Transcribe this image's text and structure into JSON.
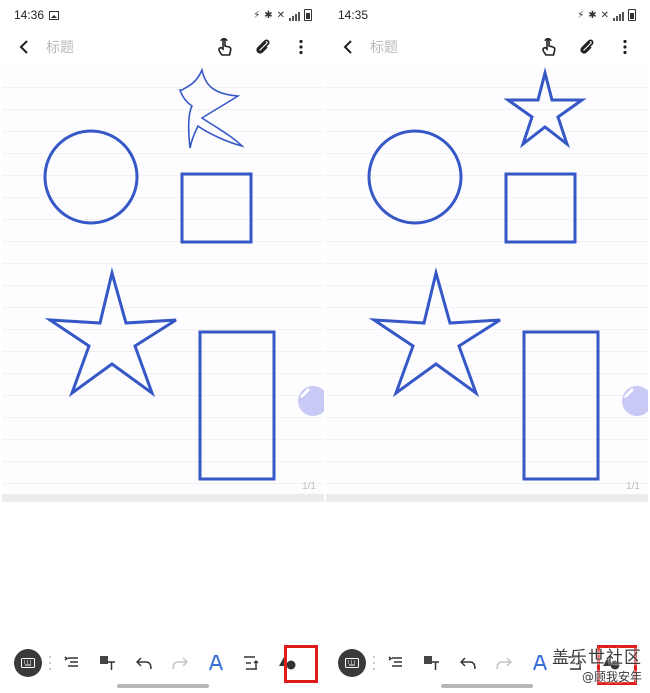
{
  "colors": {
    "shape_stroke": "#3558c6",
    "highlight": "#e01b1b",
    "fab": "#c8c9f5"
  },
  "screens": [
    {
      "status": {
        "time": "14:36"
      },
      "header": {
        "title_placeholder": "标题"
      },
      "canvas": {
        "page_indicator": "1/1",
        "shapes": [
          "hand-drawn-star",
          "circle",
          "square",
          "star",
          "tall-rectangle"
        ]
      },
      "toolbar": {
        "tools": [
          "keyboard-icon",
          "text-align-icon",
          "handwriting-to-text-icon",
          "undo-icon",
          "redo-icon",
          "pen-style-icon",
          "text-size-icon",
          "shape-recognition-icon"
        ]
      }
    },
    {
      "status": {
        "time": "14:35"
      },
      "header": {
        "title_placeholder": "标题"
      },
      "canvas": {
        "page_indicator": "1/1",
        "shapes": [
          "star",
          "circle",
          "square",
          "star",
          "tall-rectangle"
        ]
      },
      "toolbar": {
        "tools": [
          "keyboard-icon",
          "text-align-icon",
          "handwriting-to-text-icon",
          "undo-icon",
          "redo-icon",
          "pen-style-icon",
          "text-size-icon",
          "shape-recognition-icon"
        ]
      }
    }
  ],
  "watermark": {
    "line1": "盖乐世社区",
    "line2": "@顾我安年"
  }
}
